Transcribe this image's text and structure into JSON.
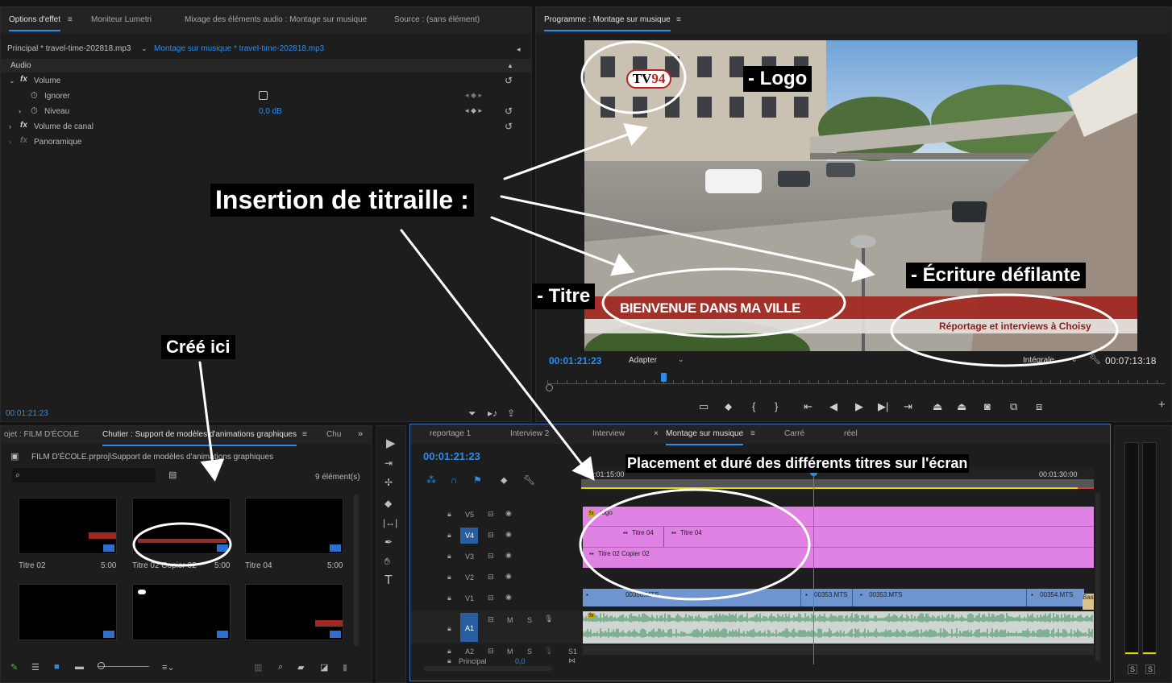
{
  "effects_panel": {
    "tabs": [
      "Options d'effet",
      "Moniteur Lumetri",
      "Mixage des éléments audio : Montage sur musique",
      "Source : (sans élément)"
    ],
    "menu_icon": "hamburger-menu-icon",
    "source_clip": "Principal * travel-time-202818.mp3",
    "target_clip": "Montage sur musique * travel-time-202818.mp3",
    "section": "Audio",
    "rows": [
      {
        "label": "Volume",
        "kind": "fx"
      },
      {
        "label": "Ignorer",
        "kind": "param"
      },
      {
        "label": "Niveau",
        "kind": "param",
        "value": "0,0 dB"
      },
      {
        "label": "Volume de canal",
        "kind": "fx"
      },
      {
        "label": "Panoramique",
        "kind": "fx"
      }
    ],
    "timecode": "00:01:21:23"
  },
  "program_monitor": {
    "title": "Programme : Montage sur musique",
    "timecode": "00:01:21:23",
    "fit": "Adapter",
    "quality": "Intégrale",
    "duration": "00:07:13:18",
    "video": {
      "logo_text_tv": "TV",
      "logo_text_num": "94",
      "title_text": "BIENVENUE DANS MA VILLE",
      "scroll_text": "Réportage et interviews à Choisy"
    }
  },
  "project_panel": {
    "tab_project": "ojet : FILM D'ÉCOLE",
    "tab_bin": "Chutier : Support de modèles d'animations graphiques",
    "tab_more": "Chu",
    "path": "FILM D'ÉCOLE.prproj\\Support de modèles d'animations graphiques",
    "item_count": "9 élément(s)",
    "items": [
      {
        "name": "Titre 02",
        "duration": "5:00"
      },
      {
        "name": "Titre 02 Copier 02",
        "duration": "5:00"
      },
      {
        "name": "Titre 04",
        "duration": "5:00"
      },
      {
        "name": "",
        "duration": ""
      },
      {
        "name": "",
        "duration": ""
      },
      {
        "name": "",
        "duration": ""
      }
    ]
  },
  "timeline": {
    "tabs": [
      "reportage 1",
      "Interview 2",
      "Interview",
      "Montage sur musique",
      "Carré",
      "réel"
    ],
    "timecode": "00:01:21:23",
    "ruler_start": "00:01:15:00",
    "ruler_end": "00:01:30:00",
    "video_tracks": [
      "V5",
      "V4",
      "V3",
      "V2",
      "V1"
    ],
    "audio_tracks": [
      "A1",
      "A2"
    ],
    "audio_letters": {
      "m": "M",
      "s": "S"
    },
    "master_label": "Principal",
    "master_value": "0,0",
    "clips": {
      "logo": "logo",
      "titre04a": "Titre 04",
      "titre04b": "Titre 04",
      "titre02copie": "Titre 02 Copier 02",
      "mts1": "00350.MTS",
      "mts2": "00353.MTS",
      "mts3": "00353.MTS",
      "mts4": "00354.MTS",
      "mts5": "Bas"
    },
    "a2_extra": "S1"
  },
  "annotations": {
    "insertion": "Insertion de titraille :",
    "logo": "- Logo",
    "titre": "- Titre",
    "ecriture": "- Écriture défilante",
    "cree_ici": "Créé ici",
    "placement": "Placement et duré des différents titres sur l'écran"
  },
  "meter": {
    "labels": [
      "S",
      "S"
    ]
  },
  "colors": {
    "accent_blue": "#2d8ceb",
    "graphics_clip": "#e082e3",
    "video_clip": "#6e95cf",
    "audio_wave": "#2f8a57",
    "timeline_yellow": "#e8d400"
  }
}
